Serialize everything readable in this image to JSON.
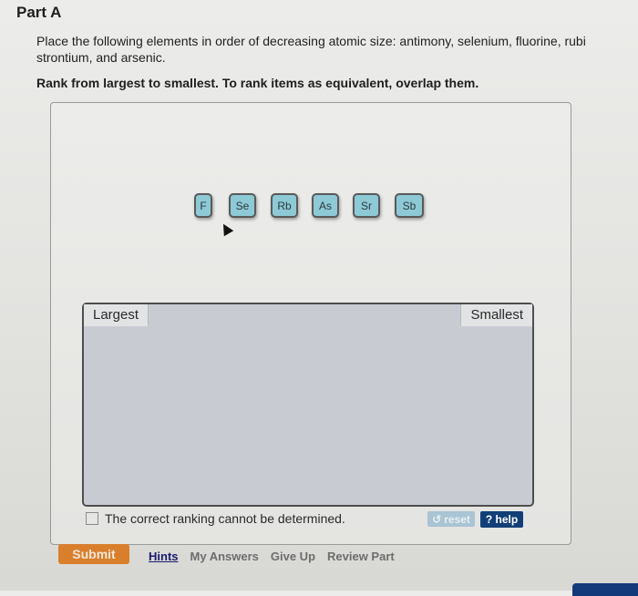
{
  "part_title": "Part A",
  "question": {
    "line1": "Place the following elements in order of decreasing atomic size: antimony, selenium, fluorine, rubi",
    "line2": "strontium, and arsenic."
  },
  "instruction": "Rank from largest to smallest. To rank items as equivalent, overlap them.",
  "tiles": [
    {
      "symbol": "F"
    },
    {
      "symbol": "Se"
    },
    {
      "symbol": "Rb"
    },
    {
      "symbol": "As"
    },
    {
      "symbol": "Sr"
    },
    {
      "symbol": "Sb"
    }
  ],
  "ranking_box": {
    "left_label": "Largest",
    "right_label": "Smallest"
  },
  "cannot_determine_label": "The correct ranking cannot be determined.",
  "cannot_determine_checked": false,
  "buttons": {
    "reset": "reset",
    "help": "? help",
    "submit": "Submit"
  },
  "links": {
    "hints": "Hints",
    "my_answers": "My Answers",
    "give_up": "Give Up",
    "review_part": "Review Part"
  },
  "colors": {
    "tile_fill": "#8ec9d6",
    "submit": "#d97f2c",
    "help": "#123f78",
    "reset": "#a9c4d3"
  }
}
